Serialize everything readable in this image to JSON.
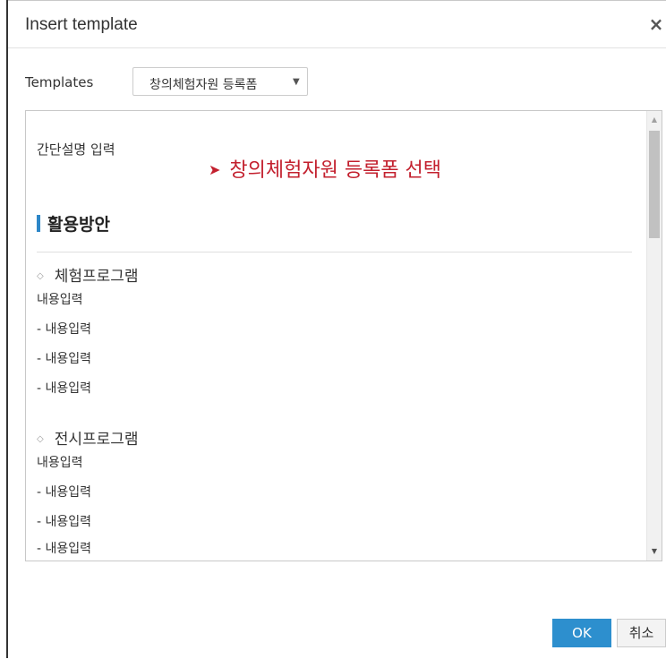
{
  "dialog": {
    "title": "Insert template",
    "close_symbol": "×",
    "templates_label": "Templates",
    "selected_template": "창의체험자원 등록폼",
    "select_arrow": "▼",
    "ok_label": "OK",
    "cancel_label": "취소"
  },
  "preview": {
    "description": "간단설명 입력",
    "annotation_arrow": "➤",
    "annotation": "창의체험자원 등록폼 선택",
    "section_title": "활용방안",
    "subhead_symbol": "◇",
    "groups": [
      {
        "heading": "체험프로그램",
        "lines": [
          "내용입력",
          "- 내용입력",
          "- 내용입력",
          "- 내용입력"
        ]
      },
      {
        "heading": "전시프로그램",
        "lines": [
          "내용입력",
          "- 내용입력",
          "- 내용입력",
          "- 내용입력"
        ]
      }
    ]
  },
  "scrollbar": {
    "up_icon": "▲",
    "down_icon": "▼"
  },
  "colors": {
    "annotation": "#c3202e",
    "section_bar": "#2d87c8",
    "ok_button": "#2d8fce"
  }
}
